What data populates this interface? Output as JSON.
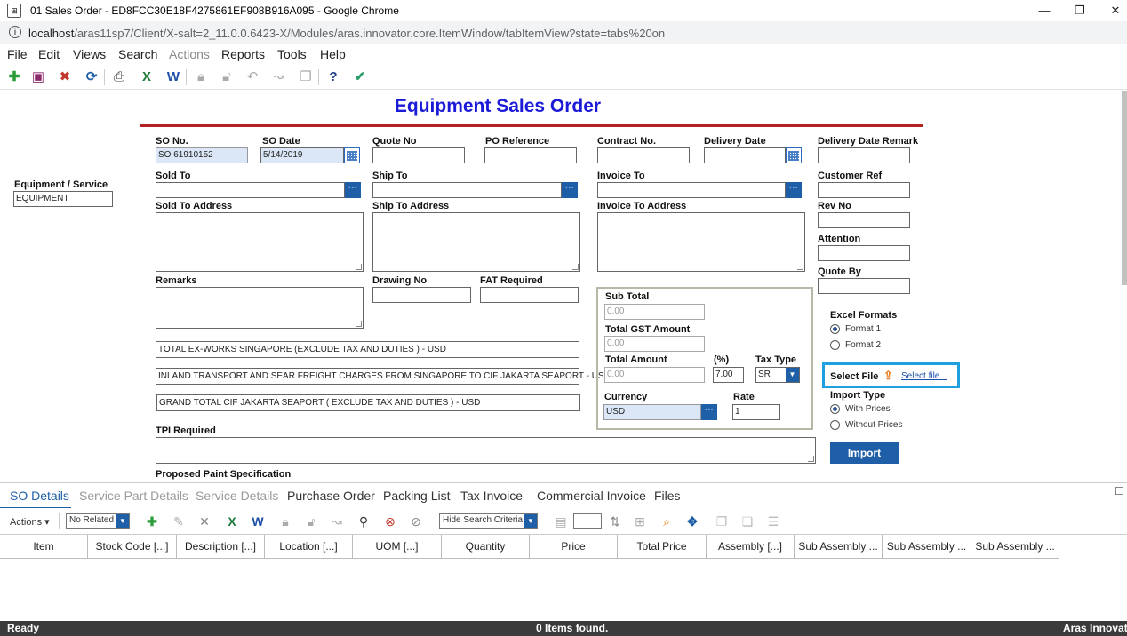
{
  "window": {
    "title": "01 Sales Order - ED8FCC30E18F4275861EF908B916A095 - Google Chrome",
    "url_host": "localhost",
    "url_path": "/aras11sp7/Client/X-salt=2_11.0.0.6423-X/Modules/aras.innovator.core.ItemWindow/tabItemView?state=tabs%20on"
  },
  "menu": [
    "File",
    "Edit",
    "Views",
    "Search",
    "Actions",
    "Reports",
    "Tools",
    "Help"
  ],
  "form": {
    "title": "Equipment Sales Order",
    "equipment_service": {
      "label": "Equipment / Service",
      "value": "EQUIPMENT"
    },
    "so_no": {
      "label": "SO No.",
      "value": "SO 61910152"
    },
    "so_date": {
      "label": "SO Date",
      "value": "5/14/2019"
    },
    "quote_no": {
      "label": "Quote No",
      "value": ""
    },
    "po_reference": {
      "label": "PO Reference",
      "value": ""
    },
    "contract_no": {
      "label": "Contract No.",
      "value": ""
    },
    "delivery_date": {
      "label": "Delivery Date",
      "value": ""
    },
    "delivery_date_remark": {
      "label": "Delivery Date Remark",
      "value": ""
    },
    "sold_to": {
      "label": "Sold To",
      "value": ""
    },
    "ship_to": {
      "label": "Ship To",
      "value": ""
    },
    "invoice_to": {
      "label": "Invoice To",
      "value": ""
    },
    "customer_ref": {
      "label": "Customer Ref",
      "value": ""
    },
    "sold_to_address": {
      "label": "Sold To Address"
    },
    "ship_to_address": {
      "label": "Ship To Address"
    },
    "invoice_to_address": {
      "label": "Invoice To Address"
    },
    "rev_no": {
      "label": "Rev No",
      "value": ""
    },
    "attention": {
      "label": "Attention",
      "value": ""
    },
    "quote_by": {
      "label": "Quote By",
      "value": ""
    },
    "remarks": {
      "label": "Remarks"
    },
    "drawing_no": {
      "label": "Drawing No",
      "value": ""
    },
    "fat_required": {
      "label": "FAT Required",
      "value": ""
    },
    "line1": "TOTAL EX-WORKS SINGAPORE (EXCLUDE TAX AND DUTIES ) - USD",
    "line2": "INLAND TRANSPORT AND SEAR FREIGHT CHARGES FROM SINGAPORE TO CIF JAKARTA SEAPORT - USD",
    "line3": "GRAND TOTAL CIF JAKARTA SEAPORT ( EXCLUDE TAX AND DUTIES ) - USD",
    "sub_total": {
      "label": "Sub Total",
      "value": "0.00"
    },
    "total_gst": {
      "label": "Total GST Amount",
      "value": "0.00"
    },
    "total_amount": {
      "label": "Total Amount",
      "value": "0.00"
    },
    "percent": {
      "label": "(%)",
      "value": "7.00"
    },
    "tax_type": {
      "label": "Tax Type",
      "value": "SR"
    },
    "currency": {
      "label": "Currency",
      "value": "USD"
    },
    "rate": {
      "label": "Rate",
      "value": "1"
    },
    "excel_formats": {
      "label": "Excel Formats",
      "options": [
        "Format 1",
        "Format 2"
      ],
      "selected": "Format 1"
    },
    "select_file": {
      "label": "Select File",
      "link": "Select file..."
    },
    "import_type": {
      "label": "Import Type",
      "options": [
        "With Prices",
        "Without Prices"
      ],
      "selected": "With Prices"
    },
    "import_button": "Import",
    "tpi_required": {
      "label": "TPI Required"
    },
    "proposed_paint": {
      "label": "Proposed Paint Specification"
    }
  },
  "tabs": [
    {
      "label": "SO Details",
      "state": "active"
    },
    {
      "label": "Service Part Details",
      "state": "disabled"
    },
    {
      "label": "Service Details",
      "state": "disabled"
    },
    {
      "label": "Purchase Order",
      "state": "normal"
    },
    {
      "label": "Packing List",
      "state": "normal"
    },
    {
      "label": "Tax Invoice",
      "state": "normal"
    },
    {
      "label": "Commercial Invoice",
      "state": "normal"
    },
    {
      "label": "Files",
      "state": "normal"
    }
  ],
  "relationship_toolbar": {
    "actions_label": "Actions",
    "related_select": "No Related",
    "search_mode_select": "Hide Search Criteria"
  },
  "grid_columns": [
    "Item",
    "Stock Code [...]",
    "Description [...]",
    "Location [...]",
    "UOM [...]",
    "Quantity",
    "Price",
    "Total Price",
    "Assembly [...]",
    "Sub Assembly ...",
    "Sub Assembly ...",
    "Sub Assembly ..."
  ],
  "status": {
    "left": "Ready",
    "center": "0 Items found.",
    "right": "Aras Innovator"
  },
  "colors": {
    "accent": "#1e5fa8",
    "title": "#1a1ad8",
    "divider": "#b22222",
    "highlight_border": "#1ea0e0"
  }
}
